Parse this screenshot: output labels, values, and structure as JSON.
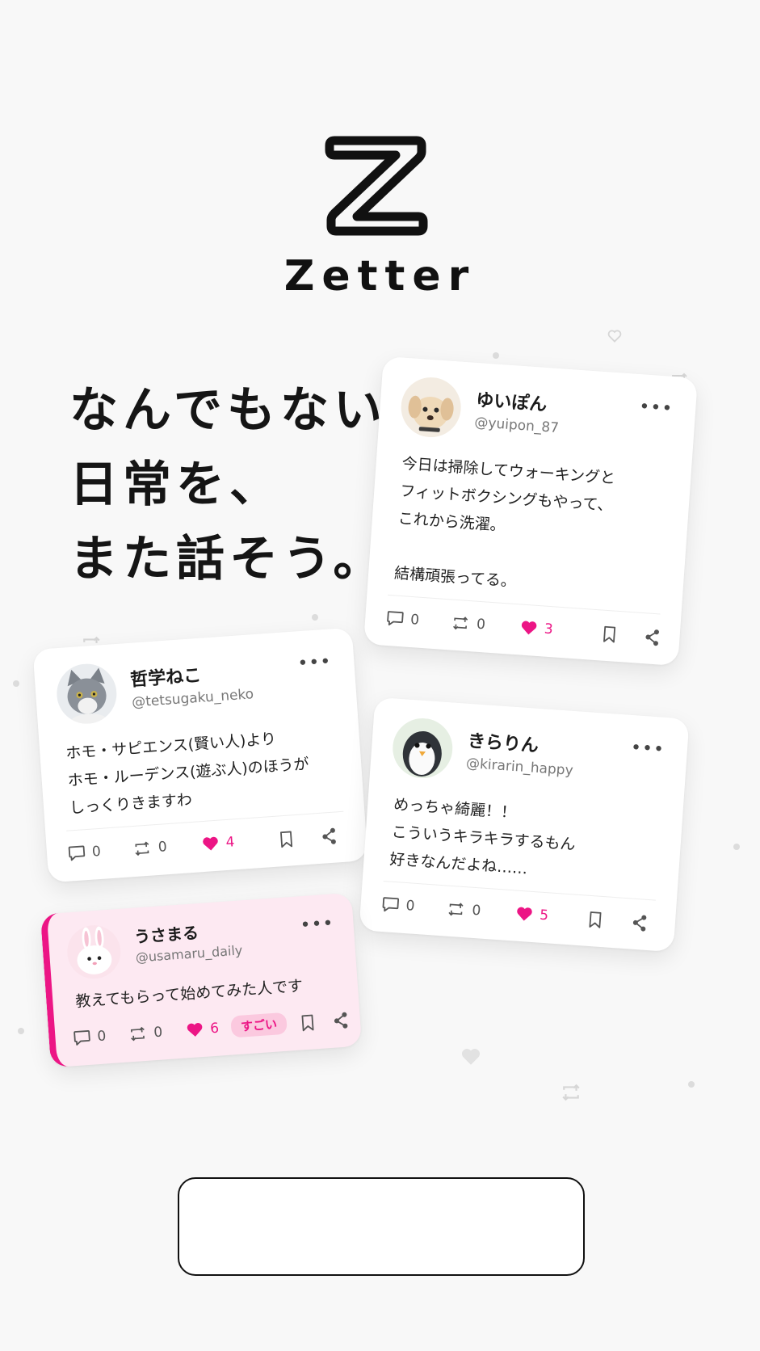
{
  "app": {
    "name": "Zetter"
  },
  "hero": {
    "lines": [
      "なんでもない",
      "日常を、",
      "また話そう。"
    ]
  },
  "posts": [
    {
      "name": "ゆいぽん",
      "handle": "@yuipon_87",
      "body": "今日は掃除してウォーキングと\nフィットボクシングもやって、\nこれから洗濯。\n\n結構頑張ってる。",
      "replies": "0",
      "reposts": "0",
      "likes": "3",
      "avatar": "puppy-avatar"
    },
    {
      "name": "哲学ねこ",
      "handle": "@tetsugaku_neko",
      "body": "ホモ・サピエンス(賢い人)より\nホモ・ルーデンス(遊ぶ人)のほうが\nしっくりきますわ",
      "replies": "0",
      "reposts": "0",
      "likes": "4",
      "avatar": "cat-avatar"
    },
    {
      "name": "きらりん",
      "handle": "@kirarin_happy",
      "body": "めっちゃ綺麗！！\nこういうキラキラするもん\n好きなんだよね……",
      "replies": "0",
      "reposts": "0",
      "likes": "5",
      "avatar": "penguin-avatar"
    },
    {
      "name": "うさまる",
      "handle": "@usamaru_daily",
      "body": "教えてもらって始めてみた人です",
      "replies": "0",
      "reposts": "0",
      "likes": "6",
      "reaction": "すごい",
      "avatar": "bunny-avatar"
    }
  ],
  "cta": {
    "label": ""
  },
  "colors": {
    "accent": "#ec1585",
    "highlight_bg": "#fde9f2"
  }
}
